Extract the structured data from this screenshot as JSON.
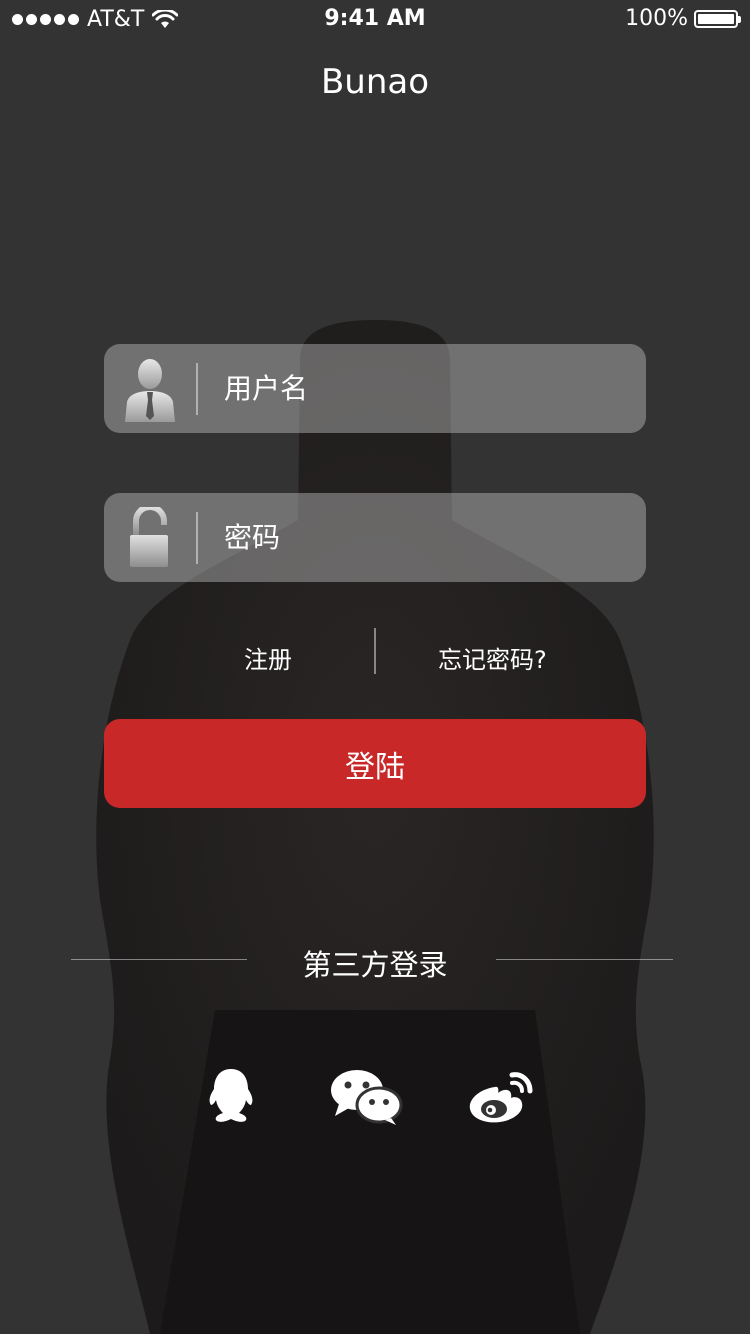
{
  "status_bar": {
    "carrier": "AT&T",
    "time": "9:41 AM",
    "battery": "100%"
  },
  "app_title": "Bunao",
  "login_form": {
    "username_placeholder": "用户名",
    "password_placeholder": "密码",
    "username_icon": "user-icon",
    "password_icon": "lock-icon"
  },
  "links": {
    "register": "注册",
    "forgot_password": "忘记密码?"
  },
  "login_button": "登陆",
  "third_party": {
    "label": "第三方登录",
    "providers": [
      {
        "icon": "qq-icon"
      },
      {
        "icon": "wechat-icon"
      },
      {
        "icon": "weibo-icon"
      }
    ]
  },
  "colors": {
    "background": "#333333",
    "accent_red": "#c82828",
    "field_bg": "rgba(200,200,200,0.42)"
  }
}
